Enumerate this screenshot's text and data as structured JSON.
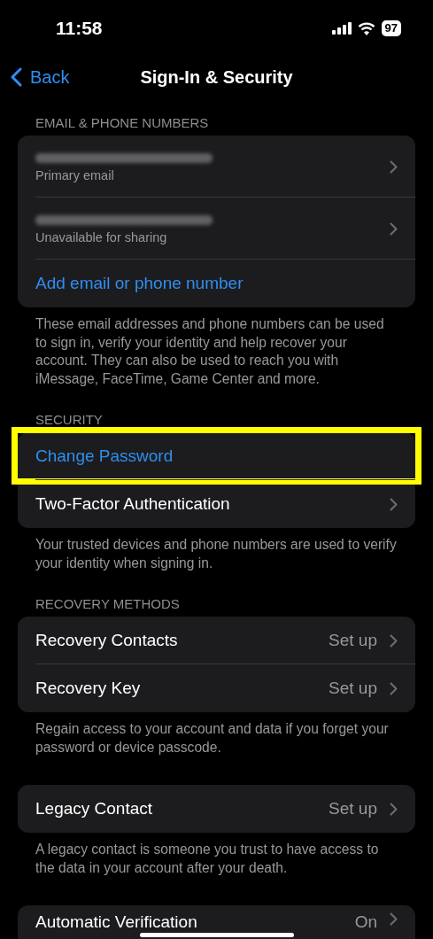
{
  "status_bar": {
    "time": "11:58",
    "battery": "97"
  },
  "nav": {
    "back": "Back",
    "title": "Sign-In & Security"
  },
  "sections": [
    {
      "header": "EMAIL & PHONE NUMBERS",
      "rows": [
        {
          "kind": "redacted",
          "subtitle": "Primary email",
          "chevron": true
        },
        {
          "kind": "redacted",
          "subtitle": "Unavailable for sharing",
          "chevron": true
        },
        {
          "kind": "link",
          "title": "Add email or phone number",
          "chevron": false
        }
      ],
      "footer": "These email addresses and phone numbers can be used to sign in, verify your identity and help recover your account. They can also be used to reach you with iMessage, FaceTime, Game Center and more."
    },
    {
      "header": "SECURITY",
      "rows": [
        {
          "kind": "link",
          "title": "Change Password",
          "chevron": false,
          "highlighted": true
        },
        {
          "kind": "plain",
          "title": "Two-Factor Authentication",
          "chevron": true
        }
      ],
      "footer": "Your trusted devices and phone numbers are used to verify your identity when signing in."
    },
    {
      "header": "RECOVERY METHODS",
      "rows": [
        {
          "kind": "plain",
          "title": "Recovery Contacts",
          "value": "Set up",
          "chevron": true
        },
        {
          "kind": "plain",
          "title": "Recovery Key",
          "value": "Set up",
          "chevron": true
        }
      ],
      "footer": "Regain access to your account and data if you forget your password or device passcode."
    },
    {
      "rows": [
        {
          "kind": "plain",
          "title": "Legacy Contact",
          "value": "Set up",
          "chevron": true
        }
      ],
      "footer": "A legacy contact is someone you trust to have access to the data in your account after your death."
    },
    {
      "rows": [
        {
          "kind": "plain",
          "title": "Automatic Verification",
          "value": "On",
          "chevron": true
        }
      ]
    }
  ]
}
